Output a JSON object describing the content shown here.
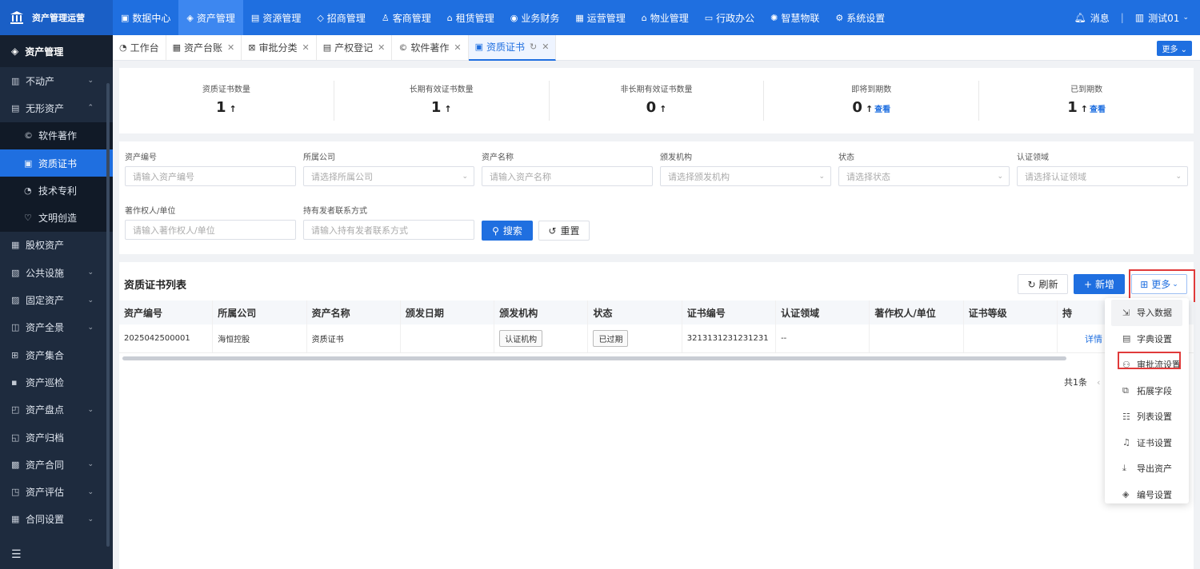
{
  "brand": {
    "title": "资产管理运营"
  },
  "topnav": [
    {
      "label": "数据中心",
      "icon": "monitor-icon"
    },
    {
      "label": "资产管理",
      "icon": "cube-icon"
    },
    {
      "label": "资源管理",
      "icon": "building-icon"
    },
    {
      "label": "招商管理",
      "icon": "tag-icon"
    },
    {
      "label": "客商管理",
      "icon": "users-icon"
    },
    {
      "label": "租赁管理",
      "icon": "house-icon"
    },
    {
      "label": "业务财务",
      "icon": "coin-icon"
    },
    {
      "label": "运营管理",
      "icon": "chart-icon"
    },
    {
      "label": "物业管理",
      "icon": "home-icon"
    },
    {
      "label": "行政办公",
      "icon": "desk-icon"
    },
    {
      "label": "智慧物联",
      "icon": "iot-icon"
    },
    {
      "label": "系统设置",
      "icon": "gear-icon"
    }
  ],
  "topright": {
    "messages": "消息",
    "user": "测试01"
  },
  "sidebar": {
    "title": "资产管理",
    "items": [
      {
        "label": "不动产",
        "chev": "⌄"
      },
      {
        "label": "无形资产",
        "chev": "⌃"
      },
      {
        "label": "软件著作",
        "sub": true
      },
      {
        "label": "资质证书",
        "sub": true,
        "active": true
      },
      {
        "label": "技术专利",
        "sub": true
      },
      {
        "label": "文明创造",
        "sub": true
      },
      {
        "label": "股权资产",
        "chev": ""
      },
      {
        "label": "公共设施",
        "chev": "⌄"
      },
      {
        "label": "固定资产",
        "chev": "⌄"
      },
      {
        "label": "资产全景",
        "chev": "⌄"
      },
      {
        "label": "资产集合",
        "chev": ""
      },
      {
        "label": "资产巡检",
        "chev": ""
      },
      {
        "label": "资产盘点",
        "chev": "⌄"
      },
      {
        "label": "资产归档",
        "chev": ""
      },
      {
        "label": "资产合同",
        "chev": "⌄"
      },
      {
        "label": "资产评估",
        "chev": "⌄"
      },
      {
        "label": "合同设置",
        "chev": "⌄"
      }
    ]
  },
  "tabs": [
    {
      "label": "工作台",
      "closable": false
    },
    {
      "label": "资产台账",
      "closable": true
    },
    {
      "label": "审批分类",
      "closable": true
    },
    {
      "label": "产权登记",
      "closable": true
    },
    {
      "label": "软件著作",
      "closable": true
    },
    {
      "label": "资质证书",
      "closable": true,
      "active": true
    }
  ],
  "tabs_more": "更多",
  "stats": [
    {
      "label": "资质证书数量",
      "value": "1",
      "link": ""
    },
    {
      "label": "长期有效证书数量",
      "value": "1",
      "link": ""
    },
    {
      "label": "非长期有效证书数量",
      "value": "0",
      "link": ""
    },
    {
      "label": "即将到期数",
      "value": "0",
      "link": "查看"
    },
    {
      "label": "已到期数",
      "value": "1",
      "link": "查看"
    }
  ],
  "filters": {
    "asset_code": {
      "label": "资产编号",
      "placeholder": "请输入资产编号"
    },
    "company": {
      "label": "所属公司",
      "placeholder": "请选择所属公司"
    },
    "asset_name": {
      "label": "资产名称",
      "placeholder": "请输入资产名称"
    },
    "issuer": {
      "label": "颁发机构",
      "placeholder": "请选择颁发机构"
    },
    "status": {
      "label": "状态",
      "placeholder": "请选择状态"
    },
    "domain": {
      "label": "认证领域",
      "placeholder": "请选择认证领域"
    },
    "owner": {
      "label": "著作权人/单位",
      "placeholder": "请输入著作权人/单位"
    },
    "contact": {
      "label": "持有发者联系方式",
      "placeholder": "请输入持有发者联系方式"
    },
    "search": "搜索",
    "reset": "重置"
  },
  "list": {
    "title": "资质证书列表",
    "refresh": "刷新",
    "add": "新增",
    "more": "更多",
    "columns": [
      "资产编号",
      "所属公司",
      "资产名称",
      "颁发日期",
      "颁发机构",
      "状态",
      "证书编号",
      "认证领域",
      "著作权人/单位",
      "证书等级",
      "持"
    ],
    "rows": [
      {
        "code": "2025042500001",
        "company": "海恒控股",
        "name": "资质证书",
        "date": "",
        "issuer": "认证机构",
        "status": "已过期",
        "cert": "3213131231231231",
        "domain": "--",
        "owner": "",
        "level": "",
        "action": "详情"
      }
    ],
    "total": "共1条"
  },
  "dropdown": [
    {
      "label": "导入数据",
      "icon": "import-icon"
    },
    {
      "label": "字典设置",
      "icon": "dictionary-icon"
    },
    {
      "label": "审批流设置",
      "icon": "workflow-icon"
    },
    {
      "label": "拓展字段",
      "icon": "extend-icon"
    },
    {
      "label": "列表设置",
      "icon": "list-icon"
    },
    {
      "label": "证书设置",
      "icon": "bell-icon"
    },
    {
      "label": "导出资产",
      "icon": "export-icon"
    },
    {
      "label": "编号设置",
      "icon": "tag-icon"
    }
  ]
}
